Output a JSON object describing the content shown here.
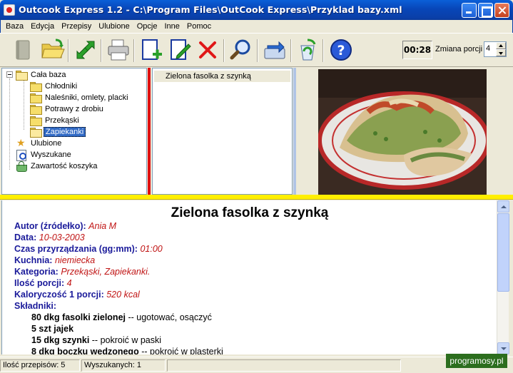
{
  "window": {
    "title": "Outcook Express 1.2 - C:\\Program Files\\OutCook Express\\Przyklad bazy.xml"
  },
  "menu": [
    "Baza",
    "Edycja",
    "Przepisy",
    "Ulubione",
    "Opcje",
    "Inne",
    "Pomoc"
  ],
  "toolbar": {
    "icons": [
      "book-icon",
      "open-folder-icon",
      "refresh-arrows-icon",
      "printer-icon",
      "add-recipe-icon",
      "edit-recipe-icon",
      "delete-icon",
      "search-icon",
      "transfer-icon",
      "recycle-icon",
      "help-icon"
    ],
    "timer": "00:28",
    "portion_label": "Zmiana porcji",
    "portion_value": "4"
  },
  "tree": {
    "root": "Cała baza",
    "categories": [
      "Chłodniki",
      "Naleśniki, omlety, placki",
      "Potrawy z drobiu",
      "Przekąski",
      "Zapiekanki"
    ],
    "selected": "Zapiekanki",
    "special": [
      "Ulubione",
      "Wyszukane",
      "Zawartość koszyka"
    ]
  },
  "list": {
    "items": [
      "Zielona fasolka z szynką"
    ]
  },
  "recipe": {
    "title": "Zielona fasolka z szynką",
    "fields": [
      {
        "k": "Autor (źródełko):",
        "v": "Ania M"
      },
      {
        "k": "Data:",
        "v": "10-03-2003"
      },
      {
        "k": "Czas przyrządzania (gg:mm):",
        "v": "01:00"
      },
      {
        "k": "Kuchnia:",
        "v": "niemiecka"
      },
      {
        "k": "Kategoria:",
        "v": "Przekąski, Zapiekanki."
      },
      {
        "k": "Ilość porcji:",
        "v": "4"
      },
      {
        "k": "Kaloryczość 1 porcji:",
        "v": "520 kcal"
      }
    ],
    "ingredients_label": "Składniki:",
    "ingredients": [
      {
        "q": "80 dkg fasolki zielonej",
        "n": " -- ugotować, osączyć"
      },
      {
        "q": "5 szt jajek",
        "n": ""
      },
      {
        "q": "15 dkg szynki",
        "n": " -- pokroić w paski"
      },
      {
        "q": "8 dkg boczku wędzonego",
        "n": " -- pokroić w plasterki"
      }
    ]
  },
  "status": {
    "count": "Ilość przepisów: 5",
    "found": "Wyszukanych: 1",
    "watermark": "programosy.pl"
  }
}
